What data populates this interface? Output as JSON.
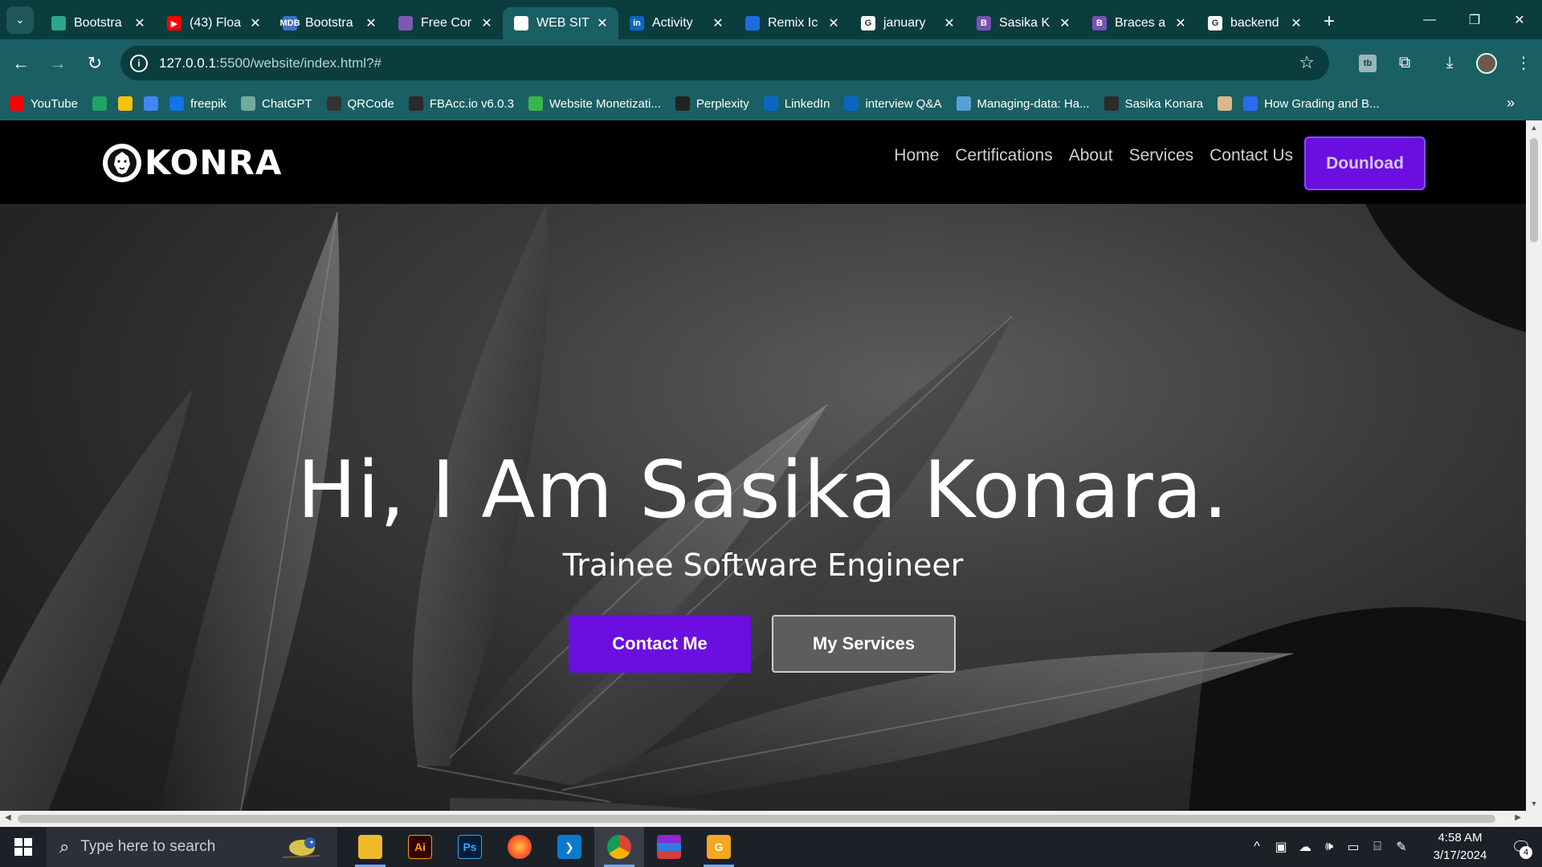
{
  "browser": {
    "tabs": [
      {
        "title": "Bootstra",
        "fav_color": "#2ea58a",
        "fav_glyph": ""
      },
      {
        "title": "(43) Floa",
        "fav_color": "#ff0000",
        "fav_glyph": "▶"
      },
      {
        "title": "Bootstra",
        "fav_color": "#3b71ca",
        "fav_glyph": "MDB"
      },
      {
        "title": "Free Cor",
        "fav_color": "#7a5ab0",
        "fav_glyph": ""
      },
      {
        "title": "WEB SIT",
        "fav_color": "#ffffff",
        "fav_glyph": ""
      },
      {
        "title": "Activity",
        "fav_color": "#0a66c2",
        "fav_glyph": "in"
      },
      {
        "title": "Remix Ic",
        "fav_color": "#1d6de0",
        "fav_glyph": ""
      },
      {
        "title": "january",
        "fav_color": "#ffffff",
        "fav_glyph": "G"
      },
      {
        "title": "Sasika K",
        "fav_color": "#7952b3",
        "fav_glyph": "B"
      },
      {
        "title": "Braces a",
        "fav_color": "#7952b3",
        "fav_glyph": "B"
      },
      {
        "title": "backend",
        "fav_color": "#ffffff",
        "fav_glyph": "G"
      }
    ],
    "active_tab_index": 4,
    "url_host": "127.0.0.1",
    "url_path": ":5500/website/index.html?#",
    "bookmarks": [
      {
        "label": "YouTube",
        "color": "#ff0000"
      },
      {
        "label": "",
        "color": "#1fa463"
      },
      {
        "label": "",
        "color": "#f4c20d"
      },
      {
        "label": "",
        "color": "#4285f4"
      },
      {
        "label": "freepik",
        "color": "#1273eb"
      },
      {
        "label": "ChatGPT",
        "color": "#74aa9c"
      },
      {
        "label": "QRCode",
        "color": "#333333"
      },
      {
        "label": "FBAcc.io v6.0.3",
        "color": "#2b2b2b"
      },
      {
        "label": "Website Monetizati...",
        "color": "#3ab54a"
      },
      {
        "label": "Perplexity",
        "color": "#222222"
      },
      {
        "label": "LinkedIn",
        "color": "#0a66c2"
      },
      {
        "label": "interview Q&A",
        "color": "#0a66c2"
      },
      {
        "label": "Managing-data: Ha...",
        "color": "#5aa0d8"
      },
      {
        "label": "Sasika Konara",
        "color": "#2b2b2b"
      },
      {
        "label": "",
        "color": "#d9b88a"
      },
      {
        "label": "How Grading and B...",
        "color": "#2a6cf0"
      }
    ]
  },
  "site": {
    "logo_text": "KONRA",
    "menu": [
      "Home",
      "Certifications",
      "About",
      "Services",
      "Contact Us"
    ],
    "download_label": "Dounload",
    "hero_title": "Hi, I Am Sasika Konara.",
    "hero_subtitle": "Trainee Software Engineer",
    "contact_button": "Contact Me",
    "services_button": "My Services",
    "accent_color": "#6a0fe0"
  },
  "taskbar": {
    "search_placeholder": "Type here to search",
    "time": "4:58 AM",
    "date": "3/17/2024",
    "notification_count": "4",
    "apps": [
      "file-explorer",
      "illustrator",
      "photoshop",
      "firefox",
      "vscode",
      "chrome",
      "winrar",
      "pdf-editor"
    ]
  }
}
